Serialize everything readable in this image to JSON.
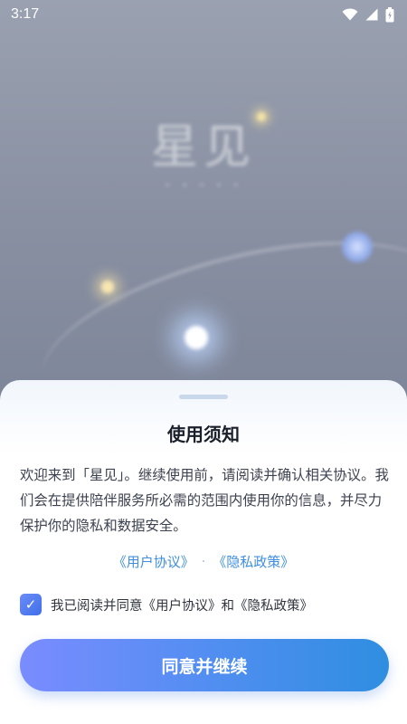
{
  "status_bar": {
    "time": "3:17",
    "icons": [
      "wifi-icon",
      "cellular-signal-icon",
      "battery-icon"
    ]
  },
  "splash": {
    "logo_text": "星见"
  },
  "dialog": {
    "title": "使用须知",
    "notice": "欢迎来到「星见」。继续使用前，请阅读并确认相关协议。我们会在提供陪伴服务所必需的范围内使用你的信息，并尽力保护你的隐私和数据安全。",
    "links": {
      "user_agreement": "《用户协议》",
      "separator": "·",
      "privacy_policy": "《隐私政策》"
    },
    "consent": {
      "checked": true,
      "check_glyph": "✓",
      "label": "我已阅读并同意《用户协议》和《隐私政策》"
    },
    "agree_button": "同意并继续"
  },
  "colors": {
    "accent": "#4f8ef0",
    "link": "#3f8fe0",
    "title": "#1b1f2a"
  }
}
